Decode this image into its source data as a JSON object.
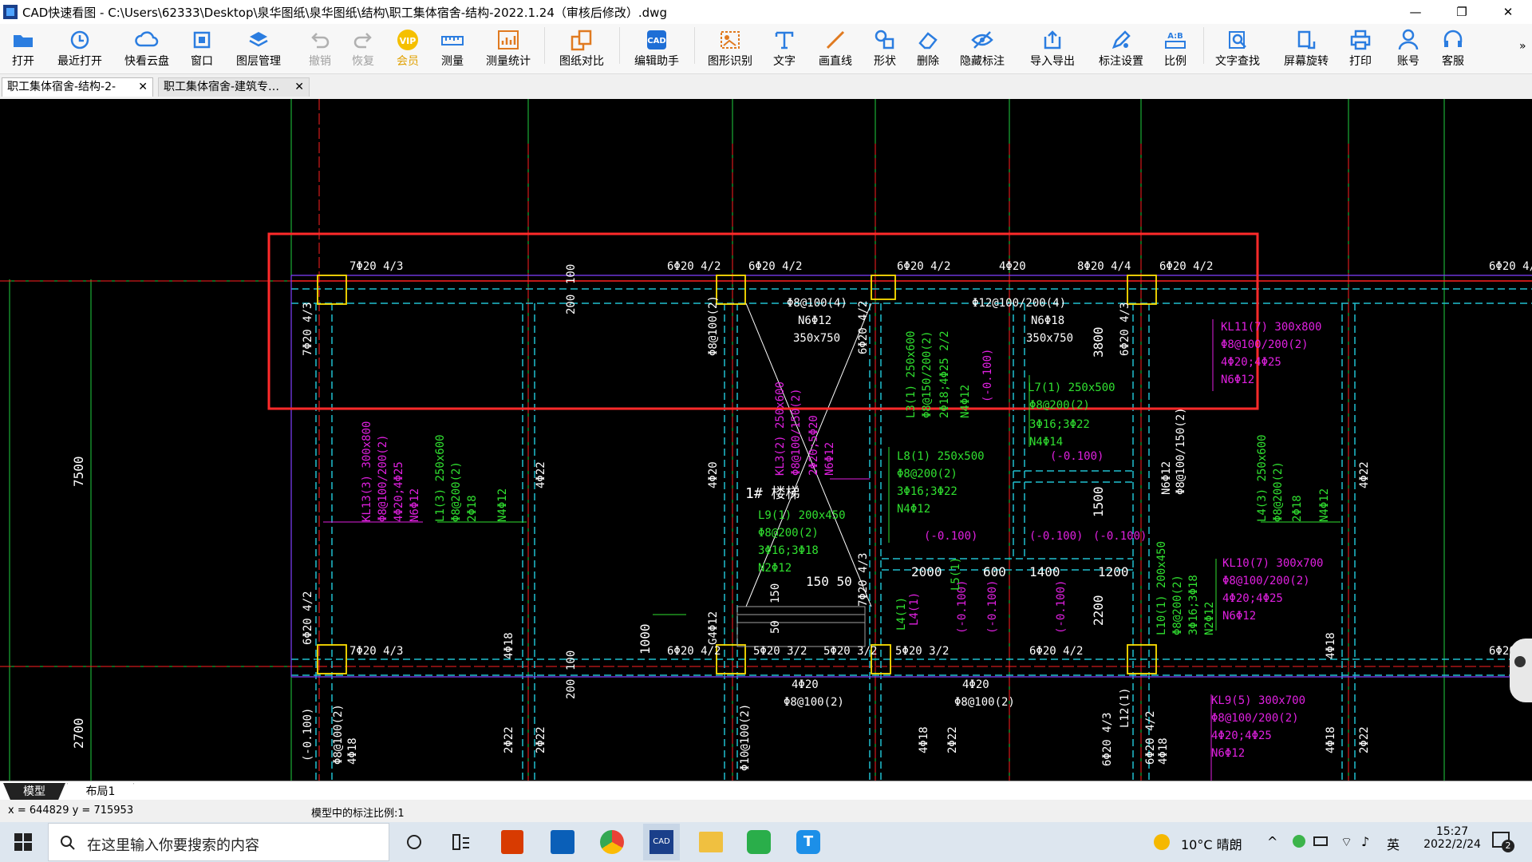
{
  "window": {
    "title": "CAD快速看图 - C:\\Users\\62333\\Desktop\\泉华图纸\\泉华图纸\\结构\\职工集体宿舍-结构-2022.1.24（审核后修改）.dwg",
    "min_icon": "minimize-icon",
    "max_icon": "maximize-icon",
    "close_icon": "close-icon"
  },
  "toolbar": {
    "open": "打开",
    "recent": "最近打开",
    "cloud": "快看云盘",
    "window": "窗口",
    "layers": "图层管理",
    "undo": "撤销",
    "redo": "恢复",
    "vip": "会员",
    "measure": "测量",
    "measure_stats": "测量统计",
    "compare": "图纸对比",
    "edit_helper": "编辑助手",
    "shape_recog": "图形识别",
    "text": "文字",
    "line": "画直线",
    "shape": "形状",
    "delete": "删除",
    "hide_mark": "隐藏标注",
    "import_export": "导入导出",
    "mark_settings": "标注设置",
    "scale": "比例",
    "text_search": "文字查找",
    "rotate": "屏幕旋转",
    "print": "打印",
    "account": "账号",
    "service": "客服",
    "more": "»"
  },
  "tabs": [
    {
      "label": "职工集体宿舍-结构-2-"
    },
    {
      "label": "职工集体宿舍-建筑专…"
    }
  ],
  "layout_tabs": {
    "model": "模型",
    "layout1": "布局1"
  },
  "status": {
    "coords": "x = 644829  y = 715953",
    "scale_text": "模型中的标注比例:1"
  },
  "drawing": {
    "beam_top": [
      "7Φ20 4/3",
      "100",
      "6Φ20 4/2",
      "6Φ20 4/2",
      "6Φ20 4/2",
      "4Φ20",
      "8Φ20 4/4",
      "6Φ20 4/2",
      "6Φ20 4/2"
    ],
    "beam_bot": [
      "7Φ20 4/3",
      "100",
      "6Φ20 4/2",
      "5Φ20 3/2",
      "5Φ20 3/2",
      "5Φ20 3/2",
      "6Φ20 4/2",
      "6Φ20"
    ],
    "kl1": [
      "Φ8@100(4)",
      "N6Φ12",
      "350x750"
    ],
    "kl2": [
      "Φ12@100/200(4)",
      "N6Φ18",
      "350x750"
    ],
    "dims": [
      "200",
      "200",
      "7500",
      "2700",
      "3800",
      "1500",
      "2200",
      "1000",
      "150",
      "50",
      "150 50",
      "2000",
      "600",
      "1400",
      "1200"
    ],
    "stair": "1# 楼梯",
    "kl11": [
      "KL11(7) 300x800",
      "Φ8@100/200(2)",
      "4Φ20;4Φ25",
      "N6Φ12"
    ],
    "kl10": [
      "KL10(7) 300x700",
      "Φ8@100/200(2)",
      "4Φ20;4Φ25",
      "N6Φ12"
    ],
    "kl9": [
      "KL9(5) 300x700",
      "Φ8@100/200(2)",
      "4Φ20;4Φ25",
      "N6Φ12"
    ],
    "kl13": [
      "KL13(3) 300x800",
      "Φ8@100/200(2)",
      "4Φ20;4Φ25",
      "N6Φ12"
    ],
    "l1": [
      "L1(3) 250x600",
      "Φ8@200(2)",
      "2Φ18",
      "N4Φ12"
    ],
    "l4": [
      "L4(3) 250x600",
      "Φ8@200(2)",
      "2Φ18",
      "N4Φ12"
    ],
    "l7": [
      "L7(1) 250x500",
      "Φ8@200(2)",
      "3Φ16;3Φ22",
      "N4Φ14",
      "(-0.100)"
    ],
    "l8": [
      "L8(1) 250x500",
      "Φ8@200(2)",
      "3Φ16;3Φ22",
      "N4Φ12"
    ],
    "l9": [
      "L9(1) 200x450",
      "Φ8@200(2)",
      "3Φ16;3Φ18",
      "N2Φ12"
    ],
    "l3": [
      "L3(1) 250x600",
      "Φ8@150/200(2)",
      "2Φ18;4Φ25 2/2",
      "N4Φ12",
      "(-0.100)"
    ],
    "l10": [
      "L10(1) 200x450",
      "Φ8@200(2)",
      "3Φ16;3Φ18",
      "N2Φ12"
    ],
    "kl3": [
      "KL3(2) 250x600",
      "Φ8@100/150(2)",
      "2Φ20;5Φ20",
      "N6Φ12"
    ],
    "levels": [
      "(-0.100)",
      "(-0.100)",
      "(-0.100)",
      "(-0.100)",
      "(-0.100)",
      "(-0.100)",
      "(-0.100)"
    ],
    "misc": [
      "4Φ22",
      "4Φ20",
      "4Φ22",
      "4Φ18",
      "4Φ18",
      "2Φ22",
      "4Φ18",
      "2Φ22",
      "Φ8@100(2)",
      "Φ8@150/200(2)",
      "6Φ20 4/2",
      "7Φ20 4/3",
      "Φ10@100(2)",
      "4Φ20",
      "Φ8@100(2)",
      "4Φ20",
      "Φ8@100(2)",
      "Φ8@100/150(2)",
      "N6Φ12",
      "6Φ20 4/2",
      "7Φ20 4/3",
      "Φ8@100(2)",
      "G4Φ12",
      "4Φ18",
      "2Φ22",
      "6Φ20 4/3",
      "6Φ20 4/2",
      "7Φ20 4/3",
      "6Φ20 4/3",
      "L12(1)",
      "(-0.100)",
      "L4(1)",
      "L5(1)"
    ]
  },
  "taskbar": {
    "search_placeholder": "在这里输入你要搜索的内容",
    "weather": "10°C 晴朗",
    "ime": "英",
    "time": "15:27",
    "date": "2022/2/24",
    "notif_count": "2"
  },
  "colors": {
    "highlight_box": "#ff2a2a",
    "beam_cyan": "#20c0d0",
    "axis_red": "#ff2020",
    "axis_green": "#20d040",
    "text_white": "#ffffff",
    "text_magenta": "#e020e0",
    "text_green": "#30e030",
    "column_yellow": "#ffe000"
  }
}
